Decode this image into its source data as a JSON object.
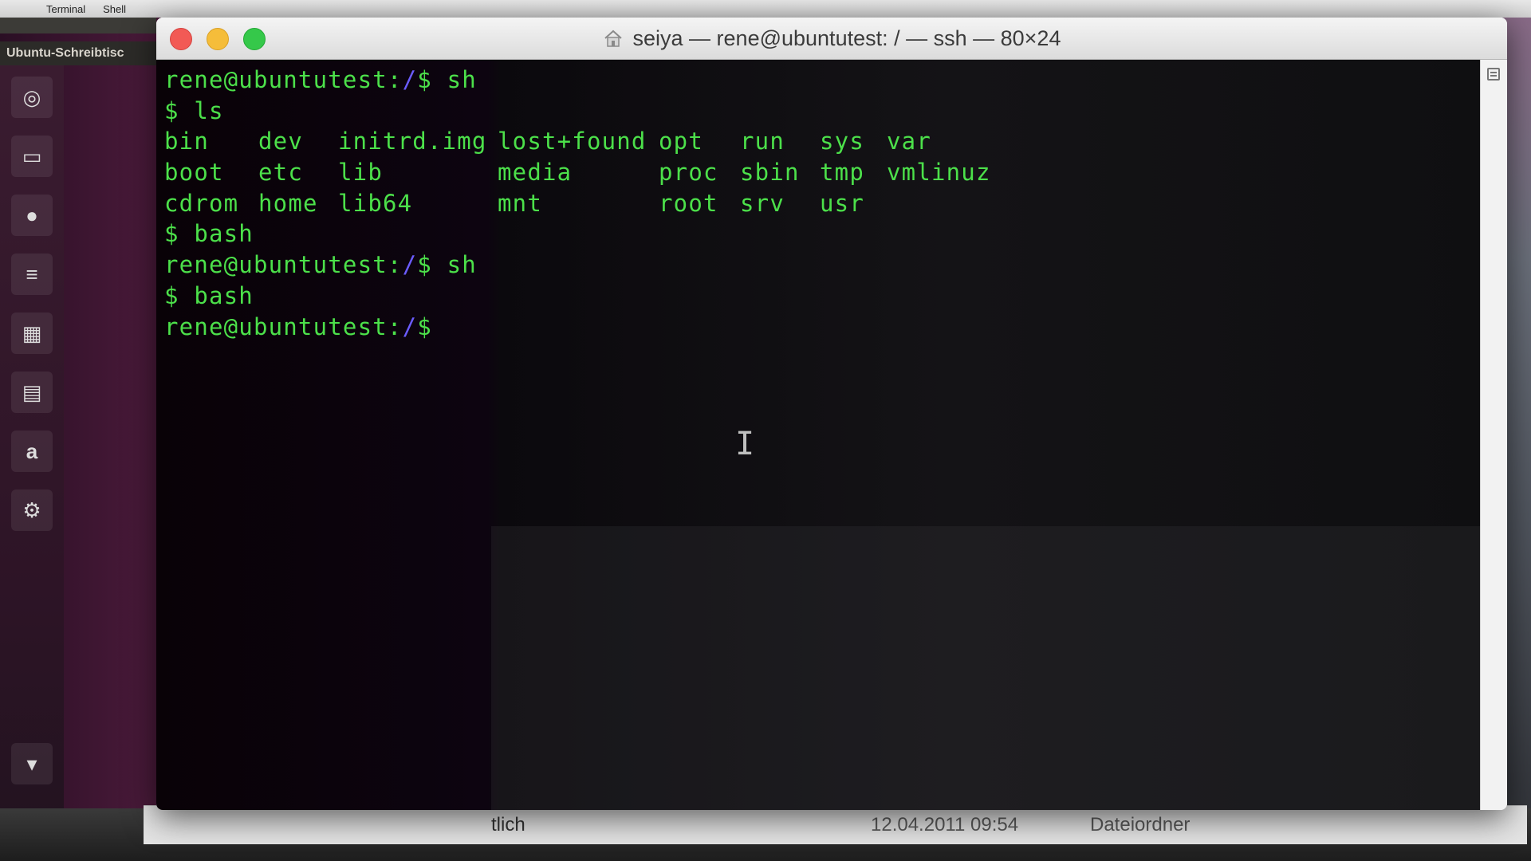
{
  "menubar": {
    "apple": "",
    "items": [
      "Terminal",
      "Shell"
    ]
  },
  "ubuntu": {
    "desktop_title": "Ubuntu-Schreibtisc",
    "launcher_icons": [
      "ubuntu-logo-icon",
      "files-icon",
      "firefox-icon",
      "writer-icon",
      "calc-icon",
      "impress-icon",
      "amazon-icon",
      "settings-icon",
      "trash-icon"
    ]
  },
  "window": {
    "title": "seiya — rene@ubuntutest: / — ssh — 80×24"
  },
  "terminal": {
    "lines": [
      {
        "type": "prompt",
        "user": "rene@ubuntutest:",
        "path": "/",
        "symbol": "$",
        "command": " sh"
      },
      {
        "type": "plain",
        "text": "$ ls"
      },
      {
        "type": "ls",
        "cells": [
          "bin",
          "dev",
          "initrd.img",
          "lost+found",
          "opt",
          "run",
          "sys",
          "var"
        ]
      },
      {
        "type": "ls",
        "cells": [
          "boot",
          "etc",
          "lib",
          "media",
          "proc",
          "sbin",
          "tmp",
          "vmlinuz"
        ]
      },
      {
        "type": "ls",
        "cells": [
          "cdrom",
          "home",
          "lib64",
          "mnt",
          "root",
          "srv",
          "usr",
          ""
        ]
      },
      {
        "type": "plain",
        "text": "$ bash"
      },
      {
        "type": "prompt",
        "user": "rene@ubuntutest:",
        "path": "/",
        "symbol": "$",
        "command": " sh"
      },
      {
        "type": "plain",
        "text": "$ bash"
      },
      {
        "type": "prompt",
        "user": "rene@ubuntutest:",
        "path": "/",
        "symbol": "$",
        "command": ""
      }
    ]
  },
  "finder_row": {
    "kind_fragment": "tlich",
    "date": "12.04.2011 09:54",
    "type": "Dateiordner"
  },
  "colors": {
    "terminal_text": "#4ce04a",
    "path": "#6b5cff"
  }
}
